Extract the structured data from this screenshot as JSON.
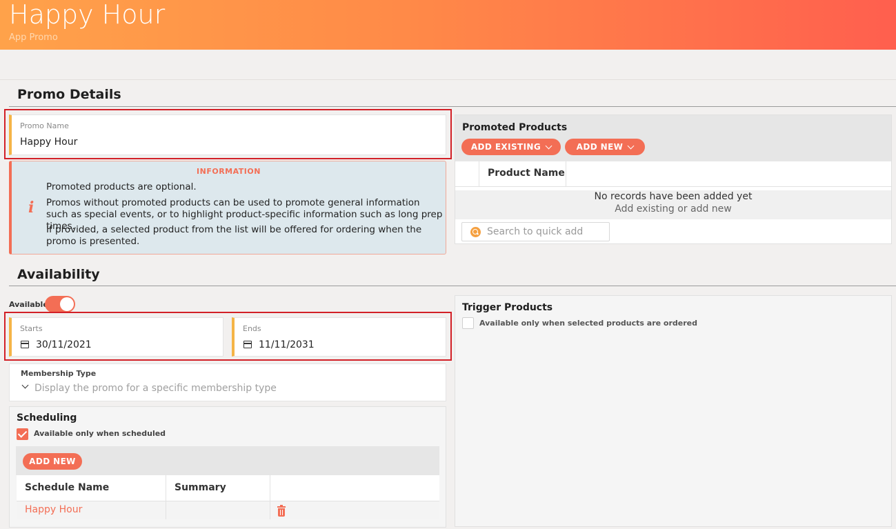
{
  "header": {
    "title": "Happy Hour",
    "subtitle": "App Promo"
  },
  "promo_details": {
    "section_title": "Promo Details",
    "promo_name": {
      "label": "Promo Name",
      "value": "Happy Hour"
    },
    "information": {
      "heading": "INFORMATION",
      "icon": "info-icon",
      "lines": [
        "Promoted products are optional.",
        "Promos without promoted products can be used to promote general information such as special events, or to highlight product-specific information such as long prep times.",
        "If provided, a selected product from the list will be offered for ordering when the promo is presented."
      ]
    },
    "promoted_products": {
      "title": "Promoted Products",
      "add_existing_label": "ADD EXISTING",
      "add_new_label": "ADD NEW",
      "column_header": "Product Name",
      "empty_title": "No records have been added yet",
      "empty_hint": "Add existing or add new",
      "search_placeholder": "Search to quick add"
    }
  },
  "availability": {
    "section_title": "Availability",
    "available_label": "Available",
    "available_on": true,
    "starts": {
      "label": "Starts",
      "value": "30/11/2021"
    },
    "ends": {
      "label": "Ends",
      "value": "11/11/2031"
    },
    "membership_type": {
      "label": "Membership Type",
      "placeholder": "Display the promo for a specific membership type"
    },
    "scheduling": {
      "title": "Scheduling",
      "only_when_scheduled_label": "Available only when scheduled",
      "only_when_scheduled_checked": true,
      "add_new_label": "ADD NEW",
      "columns": [
        "Schedule Name",
        "Summary"
      ],
      "rows": [
        {
          "name": "Happy Hour",
          "summary": ""
        }
      ]
    },
    "trigger_products": {
      "title": "Trigger Products",
      "only_when_ordered_label": "Available only when selected products are ordered",
      "only_when_ordered_checked": false
    }
  },
  "colors": {
    "accent": "#f36e55",
    "field_marker": "#f5b446",
    "highlight_frame": "#d21f26",
    "info_bg": "#dde8ed"
  }
}
